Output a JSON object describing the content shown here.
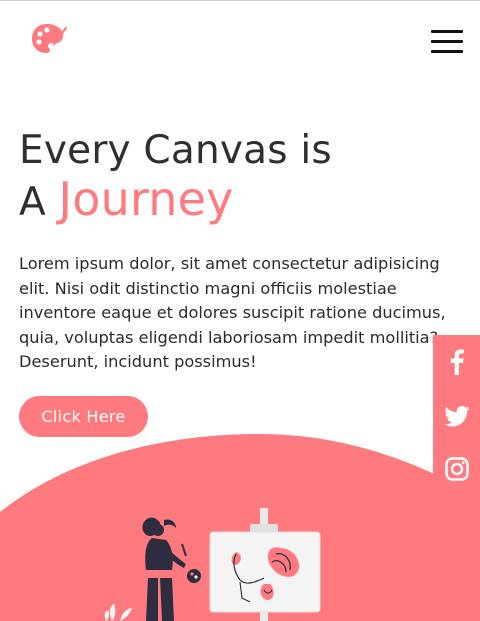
{
  "header": {
    "logo_icon": "palette-icon",
    "menu_icon": "hamburger-menu-icon"
  },
  "hero": {
    "title_line1": "Every Canvas is",
    "title_line2_prefix": "A",
    "title_line2_accent": "Journey",
    "paragraph": "Lorem ipsum dolor, sit amet consectetur adipisicing elit. Nisi odit distinctio magni officiis molestiae inventore eaque et dolores suscipit ratione ducimus, quia, voluptas eligendi laboriosam impedit mollitia? Deserunt, incidunt possimus!",
    "cta_label": "Click Here",
    "illustration": "woman-painting-on-easel-illustration"
  },
  "social": {
    "items": [
      {
        "icon": "facebook-icon"
      },
      {
        "icon": "twitter-icon"
      },
      {
        "icon": "instagram-icon"
      }
    ]
  },
  "colors": {
    "accent": "#ff7a7f",
    "text": "#2b2b2b",
    "background": "#ffffff"
  }
}
